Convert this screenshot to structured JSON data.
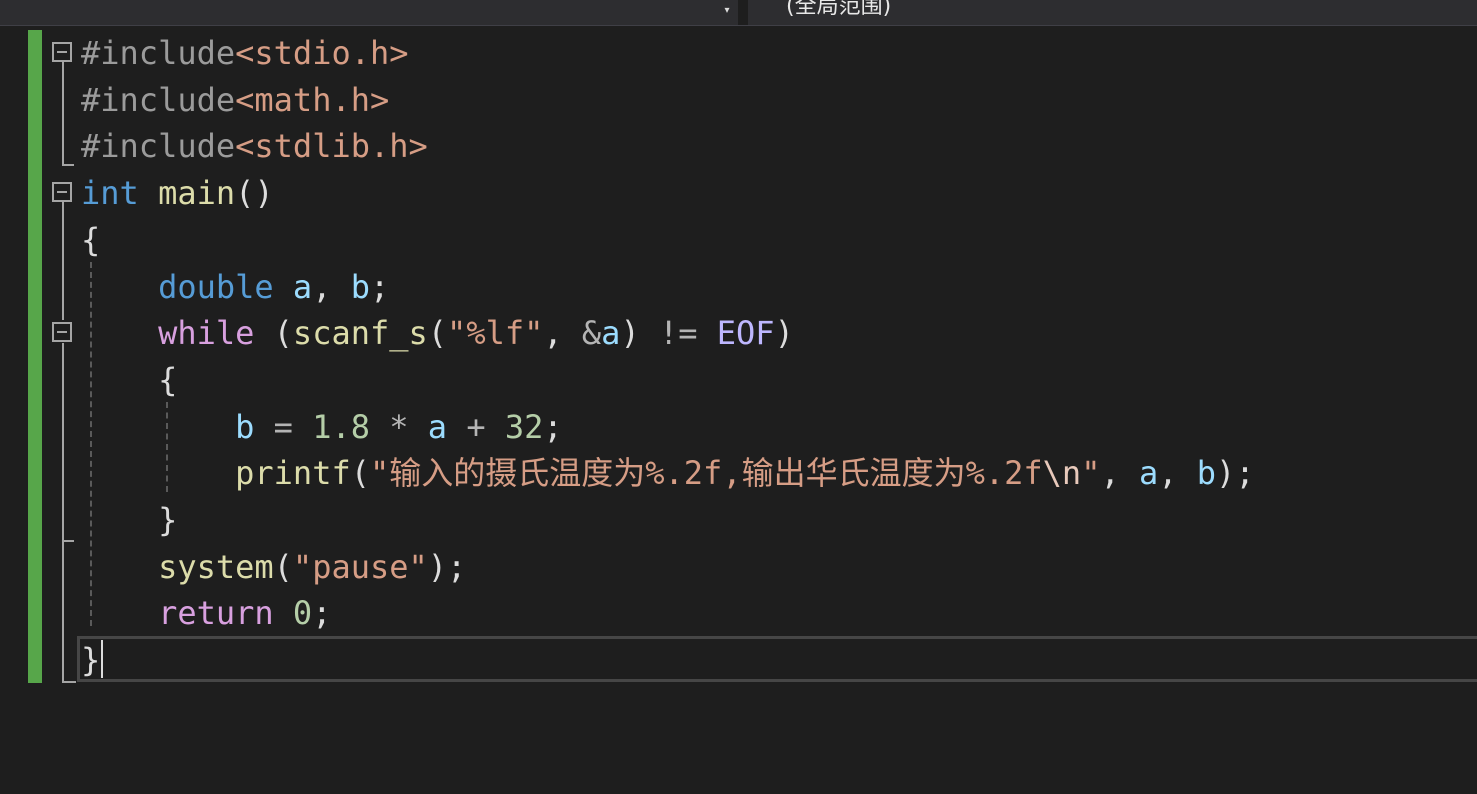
{
  "navbar": {
    "left_dropdown_arrow": "▾",
    "scope_label": "(全局范围)"
  },
  "colors": {
    "background": "#1e1e1e",
    "change_bar": "#57a64a",
    "keyword": "#569cd6",
    "control_keyword": "#d8a0df",
    "function": "#dcdcaa",
    "string": "#d69d85",
    "number": "#b5cea8",
    "variable": "#9cdcfe",
    "macro": "#beb7ff",
    "preprocessor": "#9b9b9b"
  },
  "code": {
    "lines": [
      [
        {
          "t": "#include",
          "c": "pre"
        },
        {
          "t": "<stdio.h>",
          "c": "inc"
        }
      ],
      [
        {
          "t": "#include",
          "c": "pre"
        },
        {
          "t": "<math.h>",
          "c": "inc"
        }
      ],
      [
        {
          "t": "#include",
          "c": "pre"
        },
        {
          "t": "<stdlib.h>",
          "c": "inc"
        }
      ],
      [
        {
          "t": "int",
          "c": "kw"
        },
        {
          "t": " ",
          "c": "punc"
        },
        {
          "t": "main",
          "c": "fn"
        },
        {
          "t": "()",
          "c": "punc"
        }
      ],
      [
        {
          "t": "{",
          "c": "punc"
        }
      ],
      [
        {
          "t": "    ",
          "c": "punc"
        },
        {
          "t": "double",
          "c": "kw"
        },
        {
          "t": " ",
          "c": "punc"
        },
        {
          "t": "a",
          "c": "var"
        },
        {
          "t": ", ",
          "c": "punc"
        },
        {
          "t": "b",
          "c": "var"
        },
        {
          "t": ";",
          "c": "punc"
        }
      ],
      [
        {
          "t": "    ",
          "c": "punc"
        },
        {
          "t": "while",
          "c": "ctl"
        },
        {
          "t": " (",
          "c": "punc"
        },
        {
          "t": "scanf_s",
          "c": "fn"
        },
        {
          "t": "(",
          "c": "punc"
        },
        {
          "t": "\"%lf\"",
          "c": "str"
        },
        {
          "t": ", ",
          "c": "punc"
        },
        {
          "t": "&",
          "c": "op"
        },
        {
          "t": "a",
          "c": "var"
        },
        {
          "t": ") ",
          "c": "punc"
        },
        {
          "t": "!=",
          "c": "op"
        },
        {
          "t": " ",
          "c": "punc"
        },
        {
          "t": "EOF",
          "c": "mac"
        },
        {
          "t": ")",
          "c": "punc"
        }
      ],
      [
        {
          "t": "    {",
          "c": "punc"
        }
      ],
      [
        {
          "t": "        ",
          "c": "punc"
        },
        {
          "t": "b",
          "c": "var"
        },
        {
          "t": " ",
          "c": "punc"
        },
        {
          "t": "=",
          "c": "op"
        },
        {
          "t": " ",
          "c": "punc"
        },
        {
          "t": "1.8",
          "c": "num"
        },
        {
          "t": " ",
          "c": "punc"
        },
        {
          "t": "*",
          "c": "op"
        },
        {
          "t": " ",
          "c": "punc"
        },
        {
          "t": "a",
          "c": "var"
        },
        {
          "t": " ",
          "c": "punc"
        },
        {
          "t": "+",
          "c": "op"
        },
        {
          "t": " ",
          "c": "punc"
        },
        {
          "t": "32",
          "c": "num"
        },
        {
          "t": ";",
          "c": "punc"
        }
      ],
      [
        {
          "t": "        ",
          "c": "punc"
        },
        {
          "t": "printf",
          "c": "fn"
        },
        {
          "t": "(",
          "c": "punc"
        },
        {
          "t": "\"输入的摄氏温度为%.2f,输出华氏温度为%.2f",
          "c": "str"
        },
        {
          "t": "\\n",
          "c": "esc"
        },
        {
          "t": "\"",
          "c": "str"
        },
        {
          "t": ", ",
          "c": "punc"
        },
        {
          "t": "a",
          "c": "var"
        },
        {
          "t": ", ",
          "c": "punc"
        },
        {
          "t": "b",
          "c": "var"
        },
        {
          "t": ");",
          "c": "punc"
        }
      ],
      [
        {
          "t": "    }",
          "c": "punc"
        }
      ],
      [
        {
          "t": "    ",
          "c": "punc"
        },
        {
          "t": "system",
          "c": "fn"
        },
        {
          "t": "(",
          "c": "punc"
        },
        {
          "t": "\"pause\"",
          "c": "str"
        },
        {
          "t": ");",
          "c": "punc"
        }
      ],
      [
        {
          "t": "    ",
          "c": "punc"
        },
        {
          "t": "return",
          "c": "ctl"
        },
        {
          "t": " ",
          "c": "punc"
        },
        {
          "t": "0",
          "c": "num"
        },
        {
          "t": ";",
          "c": "punc"
        }
      ],
      [
        {
          "t": "}",
          "c": "punc"
        }
      ]
    ]
  }
}
